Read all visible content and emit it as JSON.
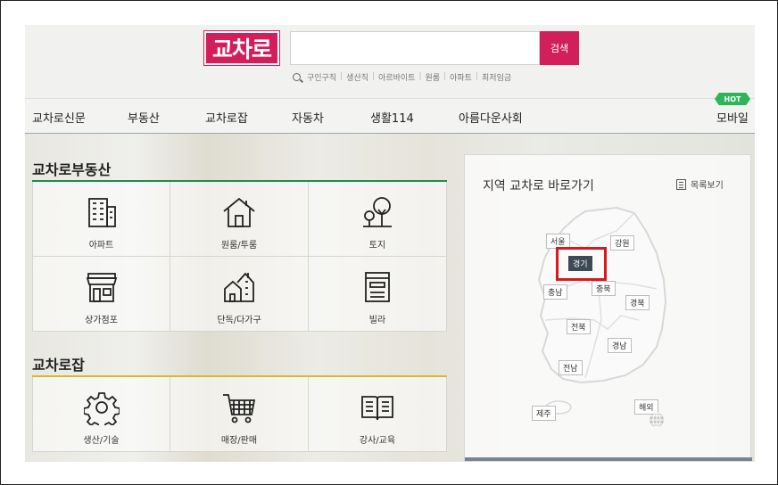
{
  "header": {
    "logo_text": "교차로",
    "search_button": "검색",
    "quick_links": [
      "구인구직",
      "생산직",
      "아르바이트",
      "원룸",
      "아파트",
      "최저임금"
    ]
  },
  "nav": {
    "items": [
      "교차로신문",
      "부동산",
      "교차로잡",
      "자동차",
      "생활114",
      "아름다운사회",
      "모바일"
    ],
    "hot_badge": "HOT"
  },
  "real_estate": {
    "title": "교차로부동산",
    "items": [
      {
        "label": "아파트",
        "icon": "apartment-icon"
      },
      {
        "label": "원룸/투룸",
        "icon": "house-icon"
      },
      {
        "label": "토지",
        "icon": "tree-land-icon"
      },
      {
        "label": "상가점포",
        "icon": "store-icon"
      },
      {
        "label": "단독/다가구",
        "icon": "multi-house-icon"
      },
      {
        "label": "빌라",
        "icon": "villa-icon"
      }
    ]
  },
  "jobs": {
    "title": "교차로잡",
    "items": [
      {
        "label": "생산/기술",
        "icon": "gear-icon"
      },
      {
        "label": "매장/판매",
        "icon": "cart-icon"
      },
      {
        "label": "강사/교육",
        "icon": "book-icon"
      }
    ]
  },
  "map": {
    "title": "지역 교차로 바로가기",
    "list_view": "목록보기",
    "regions": [
      "서울",
      "강원",
      "경기",
      "충남",
      "충북",
      "경북",
      "전북",
      "경남",
      "전남",
      "제주",
      "해외"
    ],
    "active_region": "경기"
  },
  "colors": {
    "brand": "#d21f5b",
    "green_line": "#1a8f4b",
    "yellow_line": "#d8b92c",
    "highlight": "#d8191c",
    "hot": "#2eb45b"
  }
}
